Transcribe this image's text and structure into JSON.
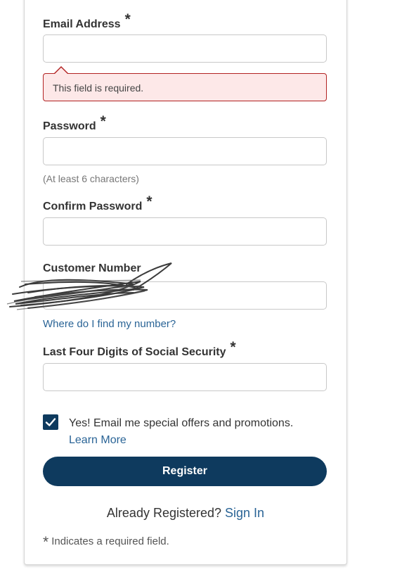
{
  "form": {
    "email": {
      "label": "Email Address",
      "required_mark": "*",
      "value": "",
      "error": "This field is required."
    },
    "password": {
      "label": "Password",
      "required_mark": "*",
      "value": "",
      "hint": "(At least 6 characters)"
    },
    "confirm_password": {
      "label": "Confirm Password",
      "required_mark": "*",
      "value": ""
    },
    "customer_number": {
      "label": "Customer Number",
      "value": "",
      "help_link": "Where do I find my number?"
    },
    "ssn_last_four": {
      "label": "Last Four Digits of Social Security",
      "required_mark": "*",
      "value": ""
    },
    "promotions": {
      "checked": true,
      "text": "Yes! Email me special offers and promotions.",
      "learn_more": "Learn More"
    },
    "register_button": "Register",
    "already_registered": "Already Registered?",
    "sign_in_link": "Sign In",
    "footnote_star": "*",
    "footnote_text": "Indicates a required field."
  },
  "colors": {
    "primary": "#0e3a5e",
    "link": "#2a6496",
    "error_border": "#b22222",
    "error_bg": "#fde8e8"
  }
}
